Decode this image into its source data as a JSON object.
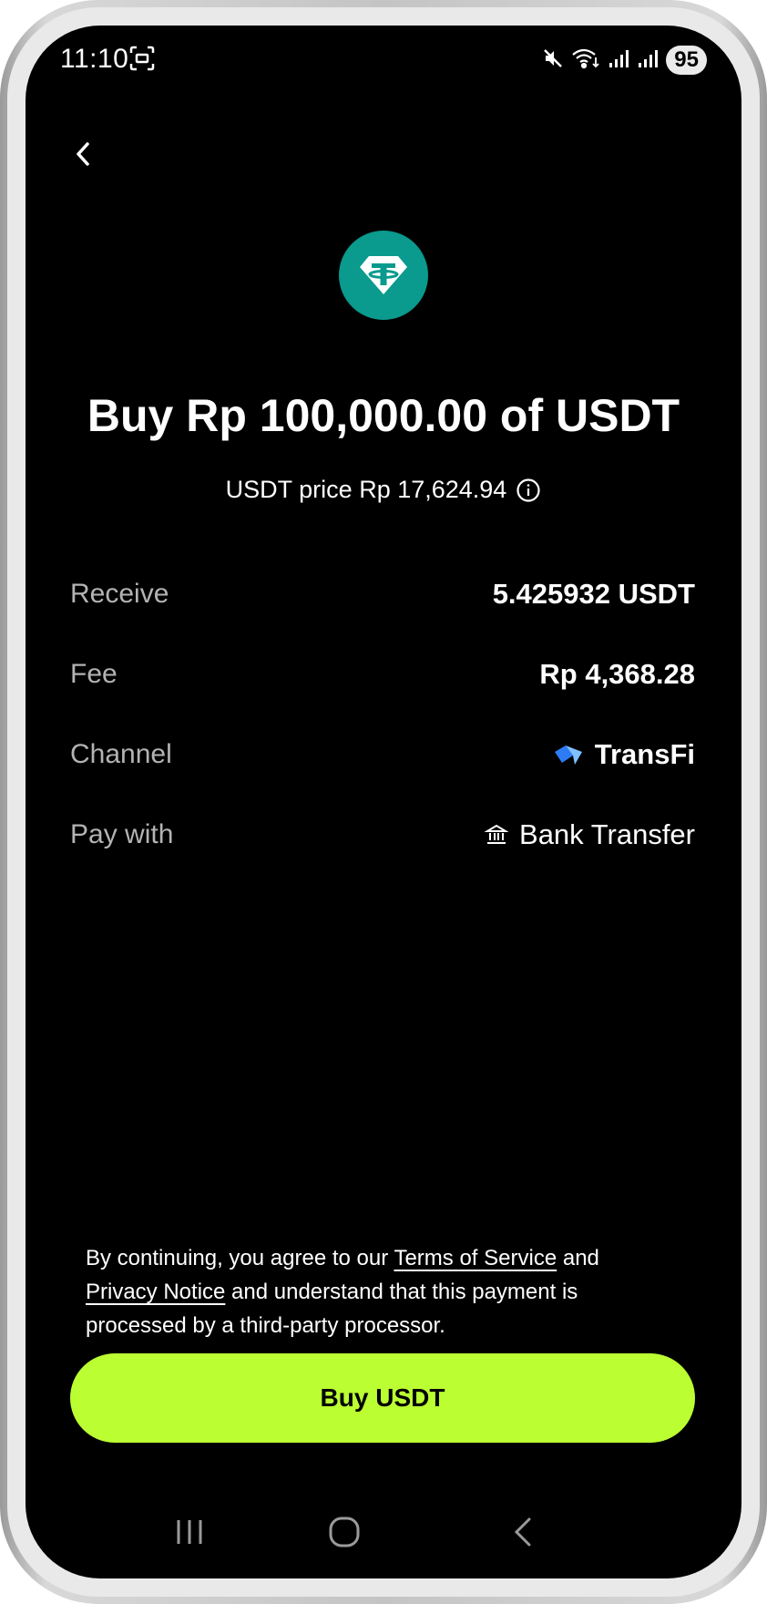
{
  "status_bar": {
    "time": "11:10",
    "battery": "95",
    "icons": [
      "screenshot-icon",
      "mute-icon",
      "wifi-icon",
      "signal-icon",
      "signal-icon"
    ]
  },
  "header": {
    "back_icon": "chevron-left-icon"
  },
  "token": {
    "icon": "tether-logo",
    "color": "#0a9a8e"
  },
  "title": "Buy Rp 100,000.00 of USDT",
  "price_line": "USDT price Rp 17,624.94",
  "details": {
    "receive_label": "Receive",
    "receive_value": "5.425932 USDT",
    "fee_label": "Fee",
    "fee_value": "Rp 4,368.28",
    "channel_label": "Channel",
    "channel_value": "TransFi",
    "pay_label": "Pay with",
    "pay_value": "Bank Transfer"
  },
  "legal": {
    "part1": "By continuing, you agree to our ",
    "terms_link": "Terms of Service",
    "part2": " and ",
    "privacy_link": "Privacy Notice",
    "part3": " and understand that this payment is processed by a third-party processor."
  },
  "cta": {
    "label": "Buy USDT",
    "color": "#bbff33"
  },
  "nav": {
    "items": [
      "recent-apps-icon",
      "home-icon",
      "back-icon"
    ]
  }
}
